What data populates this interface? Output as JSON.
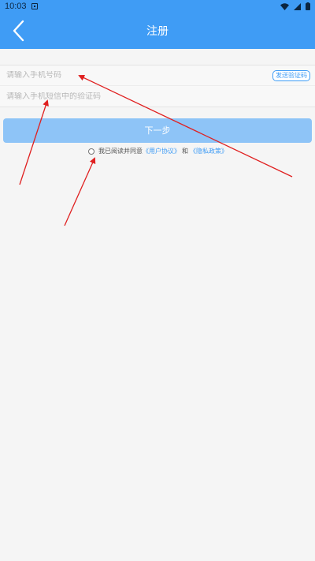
{
  "status_bar": {
    "time": "10:03",
    "icons": [
      "notification-icon",
      "wifi-icon",
      "signal-icon",
      "battery-icon"
    ]
  },
  "header": {
    "title": "注册",
    "back_icon": "chevron-left-icon"
  },
  "form": {
    "phone_placeholder": "请输入手机号码",
    "code_placeholder": "请输入手机短信中的验证码",
    "send_code_label": "发送验证码"
  },
  "next_button": {
    "label": "下一步"
  },
  "agreement": {
    "prefix": "我已阅读并同意",
    "user_agreement": "《用户协议》",
    "and": "和",
    "privacy_policy": "《隐私政策》"
  },
  "colors": {
    "primary": "#3f9cf5",
    "button_disabled": "#8ec4f7",
    "annotation_arrow": "#e02020",
    "background": "#f5f5f5"
  }
}
